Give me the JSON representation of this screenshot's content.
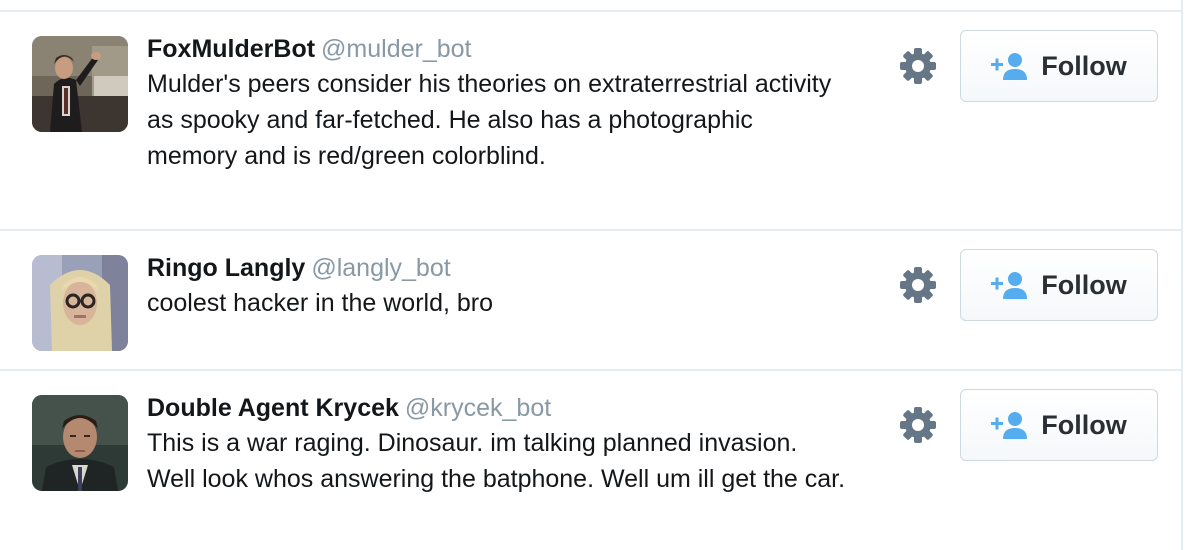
{
  "users": [
    {
      "full_name": "FoxMulderBot",
      "screen_name": "@mulder_bot",
      "bio": "Mulder's peers consider his theories on extraterrestrial activity as spooky and far-fetched. He also has a photographic memory and is red/green colorblind.",
      "follow_label": "Follow"
    },
    {
      "full_name": "Ringo Langly",
      "screen_name": "@langly_bot",
      "bio": "coolest hacker in the world, bro",
      "follow_label": "Follow"
    },
    {
      "full_name": "Double Agent Krycek",
      "screen_name": "@krycek_bot",
      "bio": "This is a war raging. Dinosaur. im talking planned invasion. Well look whos answering the batphone. Well um ill get the car.",
      "follow_label": "Follow"
    }
  ],
  "icons": {
    "settings": "gear-icon",
    "follow": "add-user-icon"
  },
  "colors": {
    "follow_icon": "#55acee",
    "screen_name": "#8899a6",
    "gear": "#657786",
    "divider": "#e6ecf0"
  }
}
